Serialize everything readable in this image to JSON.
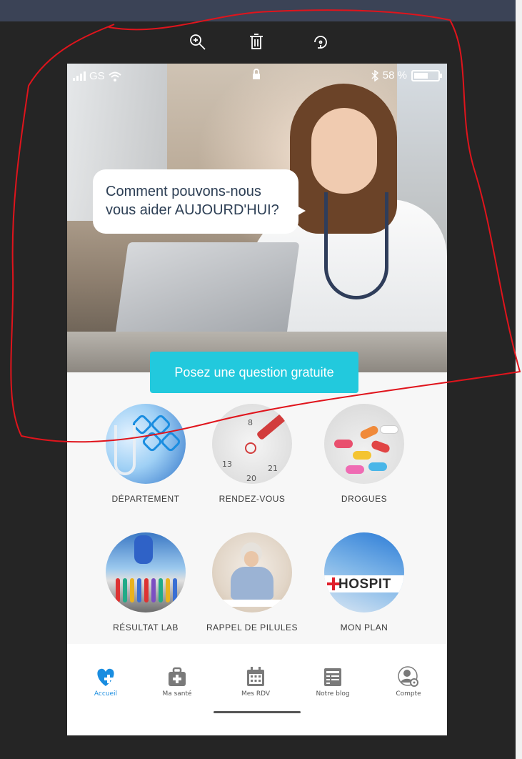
{
  "status_bar": {
    "carrier": "GS",
    "battery_text": "58 %",
    "battery_level": 0.58
  },
  "hero": {
    "prompt_line1": "Comment pouvons-nous",
    "prompt_line2": "vous aider AUJOURD'HUI?",
    "cta_label": "Posez une question gratuite"
  },
  "tiles": [
    {
      "label": "DÉPARTEMENT"
    },
    {
      "label": "RENDEZ-VOUS"
    },
    {
      "label": "DROGUES"
    },
    {
      "label": "RÉSULTAT LAB"
    },
    {
      "label": "RAPPEL DE PILULES"
    },
    {
      "label": "MON PLAN"
    }
  ],
  "calendar_numbers": [
    "8",
    "13",
    "21",
    "20"
  ],
  "hospital_sign": "HOSPIT",
  "bottom_nav": [
    {
      "label": "Accueil",
      "icon": "heart-plus-icon",
      "active": true
    },
    {
      "label": "Ma santé",
      "icon": "medical-bag-icon",
      "active": false
    },
    {
      "label": "Mes RDV",
      "icon": "calendar-icon",
      "active": false
    },
    {
      "label": "Notre blog",
      "icon": "blog-icon",
      "active": false
    },
    {
      "label": "Compte",
      "icon": "account-settings-icon",
      "active": false
    }
  ],
  "colors": {
    "accent": "#22c9dd",
    "active_nav": "#1a8de0",
    "annotation": "#e0141c"
  }
}
